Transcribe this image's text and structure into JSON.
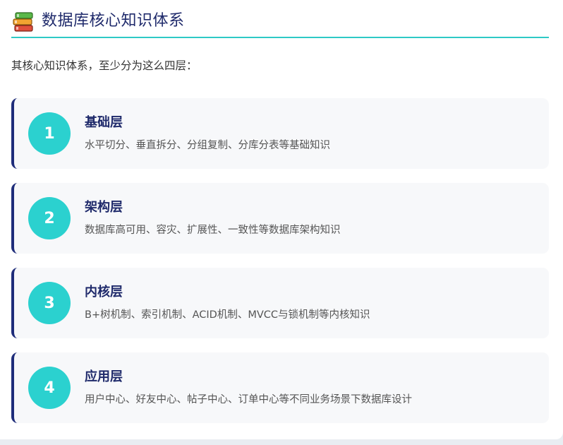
{
  "header": {
    "icon": "books-icon",
    "title": "数据库核心知识体系"
  },
  "intro": "其核心知识体系，至少分为这么四层：",
  "layers": [
    {
      "number": "1",
      "title": "基础层",
      "description": "水平切分、垂直拆分、分组复制、分库分表等基础知识"
    },
    {
      "number": "2",
      "title": "架构层",
      "description": "数据库高可用、容灾、扩展性、一致性等数据库架构知识"
    },
    {
      "number": "3",
      "title": "内核层",
      "description": "B+树机制、索引机制、ACID机制、MVCC与锁机制等内核知识"
    },
    {
      "number": "4",
      "title": "应用层",
      "description": "用户中心、好友中心、帖子中心、订单中心等不同业务场景下数据库设计"
    }
  ],
  "colors": {
    "accent_line": "#2ec9c6",
    "badge": "#2bd1cf",
    "title_text": "#1f2a6b",
    "card_border": "#1f2d7a"
  }
}
